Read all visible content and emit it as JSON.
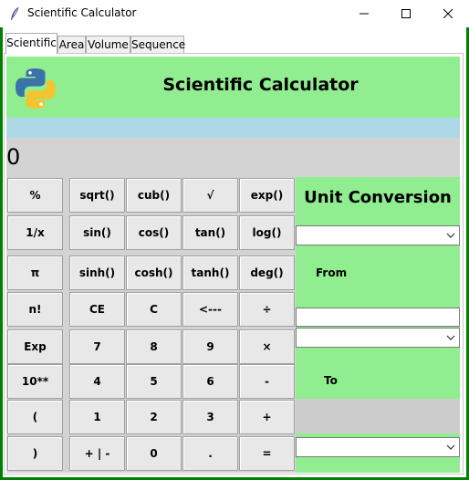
{
  "window": {
    "title": "Scientific Calculator"
  },
  "tabs": [
    {
      "label": "Scientific",
      "active": true
    },
    {
      "label": "Area",
      "active": false
    },
    {
      "label": "Volume",
      "active": false
    },
    {
      "label": "Sequence",
      "active": false
    }
  ],
  "header": {
    "title": "Scientific Calculator",
    "logo_icon": "python-logo-icon"
  },
  "display": {
    "value": "0"
  },
  "keypad": {
    "rows": [
      [
        "%",
        "sqrt()",
        "cub()",
        "√",
        "exp()"
      ],
      [
        "1/x",
        "sin()",
        "cos()",
        "tan()",
        "log()"
      ],
      [
        "π",
        "sinh()",
        "cosh()",
        "tanh()",
        "deg()"
      ],
      [
        "n!",
        "CE",
        "C",
        "<---",
        "÷"
      ],
      [
        "Exp",
        "7",
        "8",
        "9",
        "×"
      ],
      [
        "10**",
        "4",
        "5",
        "6",
        "-"
      ],
      [
        "(",
        "1",
        "2",
        "3",
        "+"
      ],
      [
        ")",
        "+ | -",
        "0",
        ".",
        "="
      ]
    ]
  },
  "unit_conversion": {
    "title": "Unit Conversion",
    "category_select_value": "",
    "from_label": "From",
    "from_value": "",
    "from_unit_select_value": "",
    "to_label": "To",
    "to_unit_select_value": ""
  },
  "colors": {
    "frame": "#008000",
    "header_bg": "#90ee90",
    "band": "#add8e6",
    "display_bg": "#d3d3d3"
  }
}
